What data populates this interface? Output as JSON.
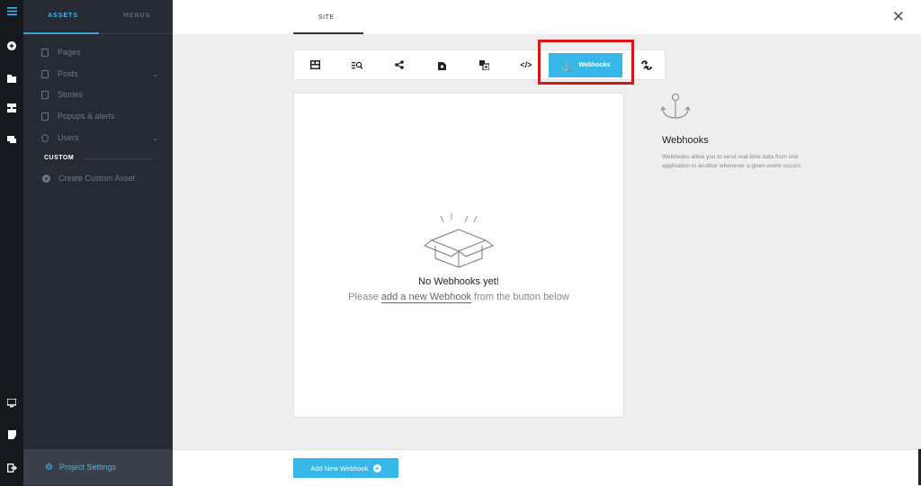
{
  "sidebar": {
    "tabs": [
      "ASSETS",
      "MENUS"
    ],
    "items": [
      {
        "label": "Pages",
        "chevron": false
      },
      {
        "label": "Posts",
        "chevron": true
      },
      {
        "label": "Stories",
        "chevron": false
      },
      {
        "label": "Popups & alerts",
        "chevron": false
      },
      {
        "label": "Users",
        "chevron": true
      }
    ],
    "section_label": "CUSTOM",
    "create_label": "Create Custom Asset",
    "settings_label": "Project Settings"
  },
  "header": {
    "site_tab": "SITE",
    "close_icon": "close-icon"
  },
  "toolbar": {
    "icons": [
      "layout-icon",
      "seo-icon",
      "share-icon",
      "image-settings-icon",
      "translate-icon",
      "code-icon",
      "webhook-icon",
      "integrations-icon"
    ],
    "active_label": "Webhooks"
  },
  "empty": {
    "title": "No Webhooks yet!",
    "sub_before": "Please ",
    "sub_link": "add a new Webhook",
    "sub_after": " from the button below"
  },
  "info": {
    "title": "Webhooks",
    "description": "Webhooks allow you to send real-time data from one application to another whenever a given event occurs."
  },
  "footer": {
    "add_button": "Add New Webhook"
  },
  "colors": {
    "accent": "#37b6e8",
    "highlight": "#d6161b",
    "sidebar_bg": "#272c34",
    "rail_bg": "#15181d"
  }
}
